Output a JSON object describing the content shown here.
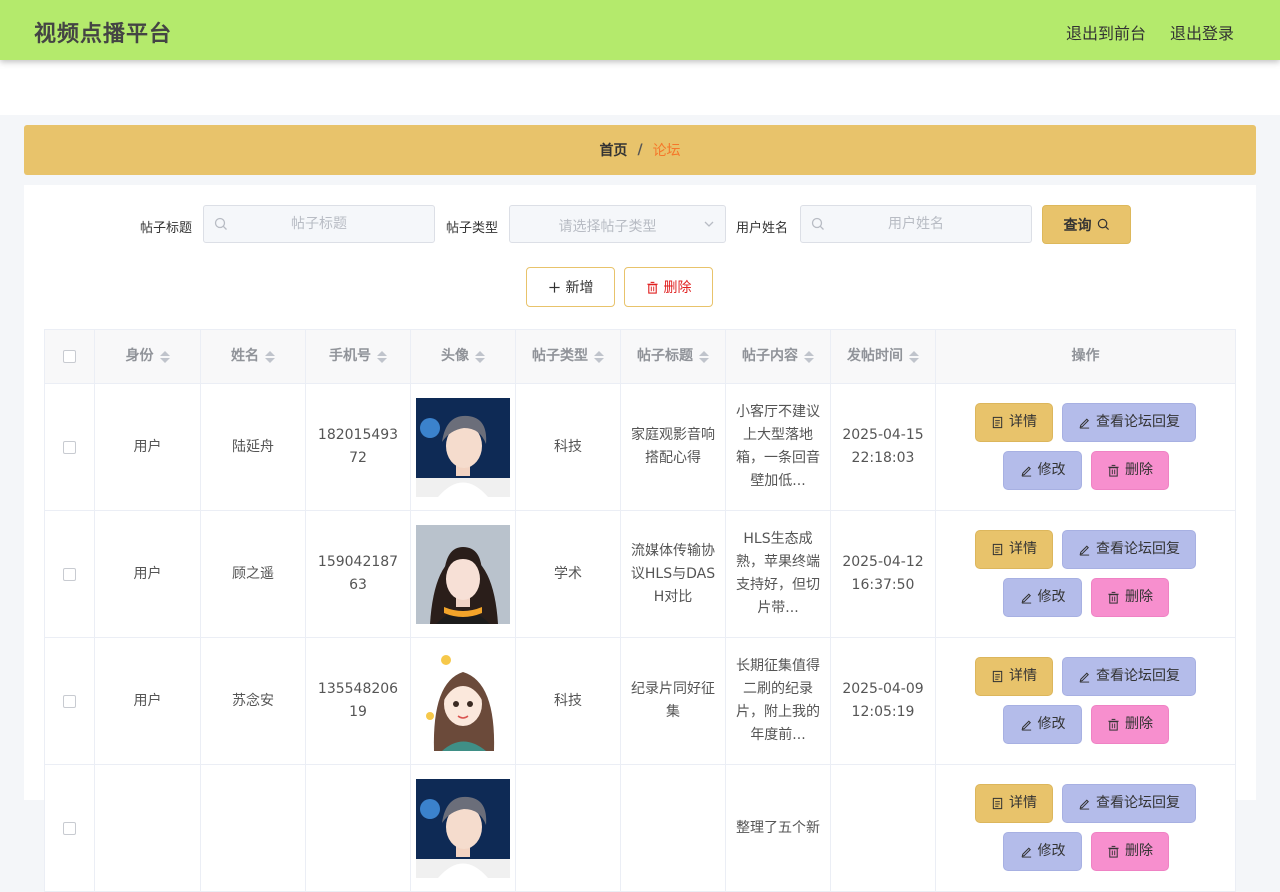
{
  "header": {
    "app_title": "视频点播平台",
    "nav": [
      {
        "label": "退出到前台"
      },
      {
        "label": "退出登录"
      }
    ],
    "bg_color": "#b4ea6c"
  },
  "breadcrumb": {
    "home": "首页",
    "separator": "/",
    "current": "论坛"
  },
  "filters": {
    "title_label": "帖子标题",
    "title_placeholder": "帖子标题",
    "type_label": "帖子类型",
    "type_placeholder": "请选择帖子类型",
    "name_label": "用户姓名",
    "name_placeholder": "用户姓名",
    "query_label": "查询"
  },
  "actions": {
    "add_label": "新增",
    "delete_label": "删除"
  },
  "table": {
    "columns": [
      "身份",
      "姓名",
      "手机号",
      "头像",
      "帖子类型",
      "帖子标题",
      "帖子内容",
      "发帖时间",
      "操作"
    ],
    "op_labels": {
      "detail": "详情",
      "reply": "查看论坛回复",
      "edit": "修改",
      "delete": "删除"
    },
    "rows": [
      {
        "role": "用户",
        "name": "陆延舟",
        "phone": "18201549372",
        "avatar": "boy-avatar",
        "type": "科技",
        "title": "家庭观影音响搭配心得",
        "content": "小客厅不建议上大型落地箱，一条回音壁加低...",
        "time": "2025-04-15 22:18:03"
      },
      {
        "role": "用户",
        "name": "顾之遥",
        "phone": "15904218763",
        "avatar": "girl-avatar",
        "type": "学术",
        "title": "流媒体传输协议HLS与DASH对比",
        "content": "HLS生态成熟，苹果终端支持好，但切片带...",
        "time": "2025-04-12 16:37:50"
      },
      {
        "role": "用户",
        "name": "苏念安",
        "phone": "13554820619",
        "avatar": "cartoon-girl-avatar",
        "type": "科技",
        "title": "纪录片同好征集",
        "content": "长期征集值得二刷的纪录片，附上我的年度前...",
        "time": "2025-04-09 12:05:19"
      },
      {
        "role": "",
        "name": "",
        "phone": "",
        "avatar": "boy-avatar",
        "type": "",
        "title": "",
        "content": "整理了五个新",
        "time": ""
      }
    ]
  },
  "colors": {
    "breadcrumb_bg": "#e8c36b",
    "breadcrumb_current": "#f5772a",
    "query_bg": "#e8c36b",
    "detail_bg": "#e8c36b",
    "reply_bg": "#b4bcea",
    "edit_bg": "#b4bcea",
    "delete_bg": "#f78fce",
    "delete_text": "#e02020"
  }
}
